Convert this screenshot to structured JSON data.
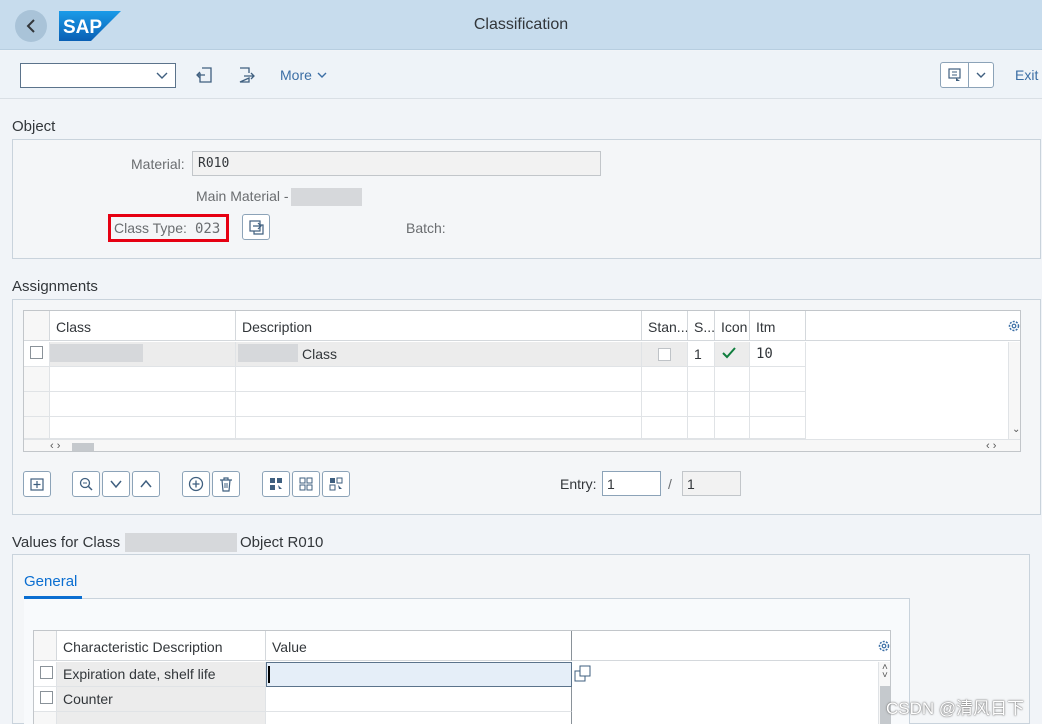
{
  "shell": {
    "title": "Classification",
    "logo_text": "SAP"
  },
  "toolbar": {
    "select_value": "",
    "more_label": "More",
    "exit_label": "Exit"
  },
  "object": {
    "section_title": "Object",
    "material_label": "Material:",
    "material_value": "R010",
    "material_desc": "Main Material -",
    "class_type_label": "Class Type:",
    "class_type_value": "023",
    "batch_label": "Batch:"
  },
  "assignments": {
    "section_title": "Assignments",
    "columns": [
      "Class",
      "Description",
      "Stan...",
      "S...",
      "Icon",
      "Itm"
    ],
    "rows": [
      {
        "class": "",
        "description": "Class",
        "standard": false,
        "status": "1",
        "icon": "check-icon",
        "itm": "10"
      }
    ],
    "entry_label": "Entry:",
    "entry_value": "1",
    "entry_sep": "/",
    "entry_total": "1"
  },
  "values": {
    "title_prefix": "Values for Class",
    "title_suffix": "Object R010",
    "tab_general": "General",
    "columns": [
      "Characteristic Description",
      "Value"
    ],
    "rows": [
      {
        "description": "Expiration date, shelf life",
        "value": ""
      },
      {
        "description": "Counter",
        "value": ""
      }
    ]
  },
  "watermark": "CSDN @清风日下",
  "colors": {
    "shell_bg": "#c7dced",
    "accent": "#0a6ed1",
    "highlight": "#e60012",
    "check": "#107e3e"
  }
}
